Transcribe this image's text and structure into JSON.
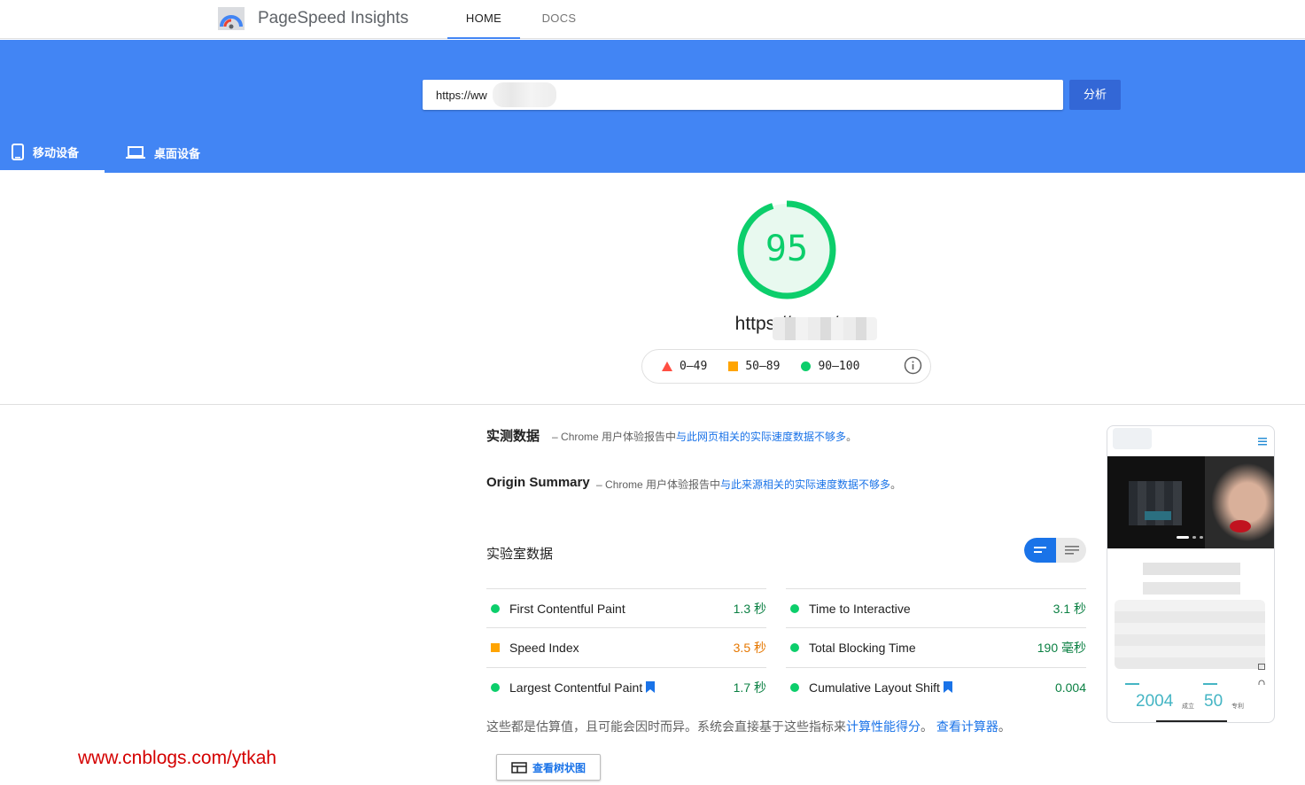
{
  "header": {
    "brand": "PageSpeed Insights",
    "nav": [
      {
        "label": "HOME",
        "active": true
      },
      {
        "label": "DOCS",
        "active": false
      }
    ]
  },
  "search": {
    "url_value": "https://ww          n/",
    "analyze_label": "分析"
  },
  "device_tabs": [
    {
      "label": "移动设备",
      "icon": "phone-icon",
      "active": true
    },
    {
      "label": "桌面设备",
      "icon": "laptop-icon",
      "active": false
    }
  ],
  "score": {
    "value": "95",
    "score_percent": 95,
    "page_url": "https://ww                n/",
    "color": "#0cce6b"
  },
  "legend": [
    {
      "range": "0–49",
      "shape": "triangle",
      "color": "#ff4e42"
    },
    {
      "range": "50–89",
      "shape": "square",
      "color": "#ffa400"
    },
    {
      "range": "90–100",
      "shape": "circle",
      "color": "#0cce6b"
    }
  ],
  "field_data": {
    "title": "实测数据",
    "dash": "–",
    "desc_prefix": "Chrome 用户体验报告中",
    "desc_link": "与此网页相关的实际速度数据不够多",
    "desc_suffix": "。"
  },
  "origin_summary": {
    "title": "Origin Summary",
    "dash": "–",
    "desc_prefix": "Chrome 用户体验报告中",
    "desc_link": "与此来源相关的实际速度数据不够多",
    "desc_suffix": "。"
  },
  "lab": {
    "title": "实验室数据",
    "metrics_left": [
      {
        "name": "First Contentful Paint",
        "value": "1.3 秒",
        "status": "good",
        "bookmark": false
      },
      {
        "name": "Speed Index",
        "value": "3.5 秒",
        "status": "average",
        "bookmark": false
      },
      {
        "name": "Largest Contentful Paint",
        "value": "1.7 秒",
        "status": "good",
        "bookmark": true
      }
    ],
    "metrics_right": [
      {
        "name": "Time to Interactive",
        "value": "3.1 秒",
        "status": "good",
        "bookmark": false
      },
      {
        "name": "Total Blocking Time",
        "value": "190 毫秒",
        "status": "good",
        "bookmark": false
      },
      {
        "name": "Cumulative Layout Shift",
        "value": "0.004",
        "status": "good",
        "bookmark": true
      }
    ],
    "footnote_prefix": "这些都是估算值，且可能会因时而异。系统会直接基于这些指标来",
    "footnote_link1": "计算性能得分",
    "footnote_mid": "。",
    "footnote_link2": "查看计算器",
    "footnote_suffix": "。",
    "treemap_label": "查看树状图"
  },
  "screenshot_thumb": {
    "stat1": "2004",
    "stat1_label": "成立",
    "stat2": "50",
    "stat2_label": "专利"
  },
  "watermark": "www.cnblogs.com/ytkah"
}
